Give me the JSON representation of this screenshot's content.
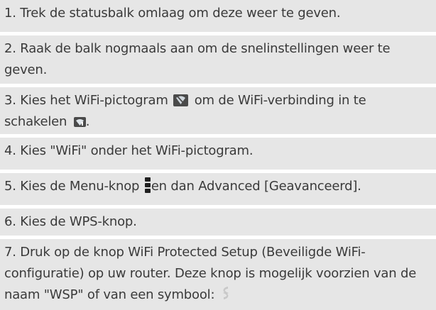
{
  "steps": [
    {
      "text": "1. Trek de statusbalk omlaag om deze weer te geven."
    },
    {
      "text": "2. Raak de balk nogmaals aan om de snelinstellingen weer te geven."
    },
    {
      "before": "3. Kies het WiFi-pictogram ",
      "middle": " om de WiFi-verbinding in te schakelen ",
      "after": "."
    },
    {
      "text": "4. Kies \"WiFi\" onder het WiFi-pictogram."
    },
    {
      "before": "5. Kies de Menu-knop ",
      "after": "en dan Advanced [Geavanceerd]."
    },
    {
      "text": "6. Kies de WPS-knop."
    },
    {
      "before": "7. Druk op de knop WiFi Protected Setup (Beveiligde WiFi-configuratie) op uw router. Deze knop is mogelijk voorzien van de naam \"WSP\" of van een symbool: "
    }
  ],
  "icons": {
    "wifi_off": "wifi-off-icon",
    "wifi_on": "wifi-on-icon",
    "menu": "menu-dots-icon",
    "wps": "wps-icon"
  },
  "colors": {
    "step_background": "#e6e6e6",
    "text": "#3a3a3a",
    "icon_dark": "#4a4a4a",
    "wps_icon": "#c8c8c8"
  }
}
